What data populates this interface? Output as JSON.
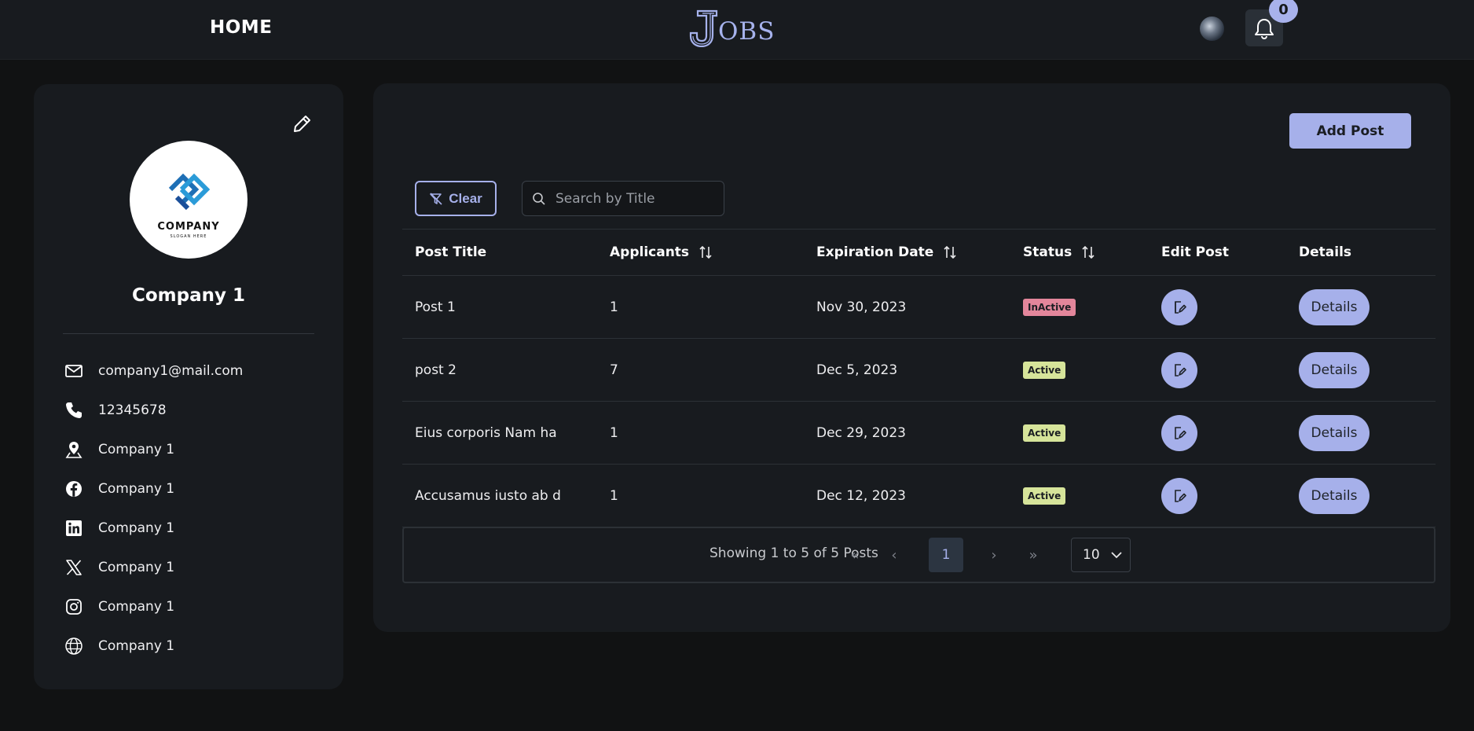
{
  "nav": {
    "home_label": "HOME",
    "logo_j": "J",
    "logo_rest": "OBS",
    "notifications_count": "0"
  },
  "profile": {
    "logo_word": "COMPANY",
    "logo_slogan": "SLOGAN HERE",
    "name": "Company 1",
    "contacts": [
      {
        "icon": "mail-icon",
        "text": "company1@mail.com"
      },
      {
        "icon": "phone-icon",
        "text": "12345678"
      },
      {
        "icon": "map-pin-icon",
        "text": "Company 1"
      },
      {
        "icon": "facebook-icon",
        "text": "Company 1"
      },
      {
        "icon": "linkedin-icon",
        "text": "Company 1"
      },
      {
        "icon": "x-twitter-icon",
        "text": "Company 1"
      },
      {
        "icon": "instagram-icon",
        "text": "Company 1"
      },
      {
        "icon": "globe-icon",
        "text": "Company 1"
      }
    ]
  },
  "posts": {
    "add_post_label": "Add Post",
    "clear_label": "Clear",
    "search_placeholder": "Search by Title",
    "columns": [
      "Post Title",
      "Applicants",
      "Expiration Date",
      "Status",
      "Edit Post",
      "Details"
    ],
    "rows": [
      {
        "title": "Post 1",
        "applicants": "1",
        "expiration": "Nov 30, 2023",
        "status": "InActive",
        "details": "Details"
      },
      {
        "title": "post 2",
        "applicants": "7",
        "expiration": "Dec 5, 2023",
        "status": "Active",
        "details": "Details"
      },
      {
        "title": "Eius corporis Nam ha",
        "applicants": "1",
        "expiration": "Dec 29, 2023",
        "status": "Active",
        "details": "Details"
      },
      {
        "title": "Accusamus iusto ab d",
        "applicants": "1",
        "expiration": "Dec 12, 2023",
        "status": "Active",
        "details": "Details"
      }
    ],
    "pagination": {
      "info": "Showing 1 to 5 of 5 Posts",
      "first": "«",
      "prev": "‹",
      "current": "1",
      "next": "›",
      "last": "»",
      "rows_per_page": "10"
    }
  },
  "colors": {
    "accent": "#a6b0ea",
    "inactive": "#e3869b",
    "active": "#d6e49a",
    "panel": "#181b1f",
    "background": "#111213"
  }
}
